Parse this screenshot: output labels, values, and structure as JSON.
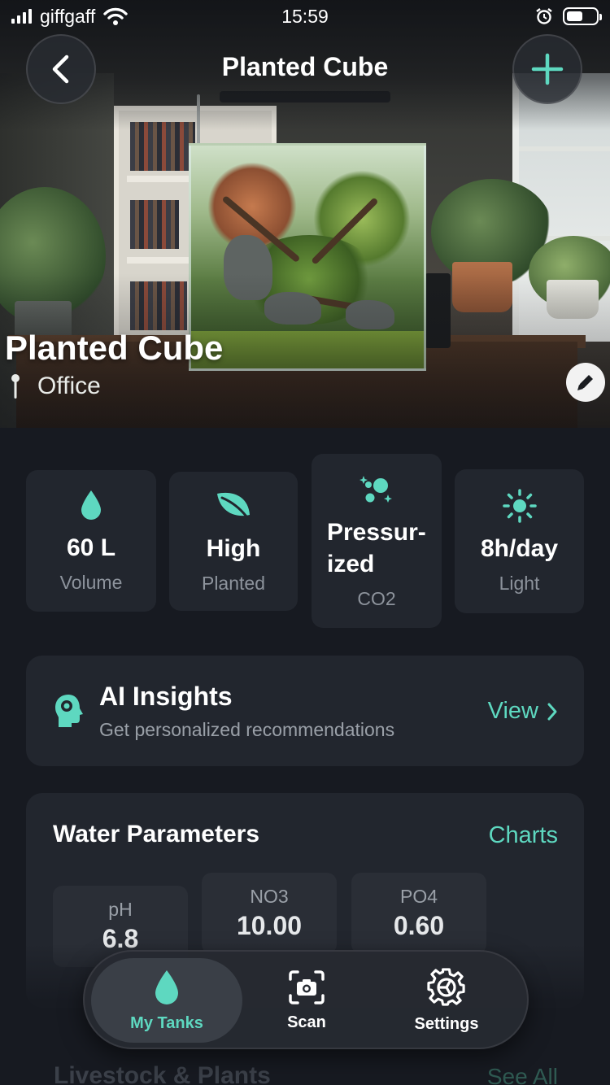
{
  "status_bar": {
    "carrier": "giffgaff",
    "time": "15:59"
  },
  "nav": {
    "title": "Planted Cube",
    "back_icon": "chevron-left-icon",
    "add_icon": "plus-icon"
  },
  "hero": {
    "tank_name": "Planted Cube",
    "location": "Office",
    "location_icon": "pin-icon",
    "edit_icon": "pencil-icon"
  },
  "stats": [
    {
      "value": "60 L",
      "label": "Volume",
      "icon": "water-drop-icon"
    },
    {
      "value": "High",
      "label": "Planted",
      "icon": "leaf-icon"
    },
    {
      "value_line1": "Pressur-",
      "value_line2": "ized",
      "label": "CO2",
      "icon": "bubbles-icon"
    },
    {
      "value": "8h/day",
      "label": "Light",
      "icon": "sun-icon"
    }
  ],
  "ai_insights": {
    "title": "AI Insights",
    "subtitle": "Get personalized recommendations",
    "action": "View",
    "icon": "brain-head-icon"
  },
  "water_parameters": {
    "title": "Water Parameters",
    "action": "Charts",
    "params": [
      {
        "label": "pH",
        "value": "6.8"
      },
      {
        "label": "NO3",
        "value": "10.00"
      },
      {
        "label": "PO4",
        "value": "0.60"
      }
    ]
  },
  "livestock": {
    "title": "Livestock & Plants",
    "action": "See All"
  },
  "tabbar": {
    "tabs": [
      {
        "label": "My Tanks",
        "icon": "water-drop-icon",
        "active": true
      },
      {
        "label": "Scan",
        "icon": "camera-scan-icon",
        "active": false
      },
      {
        "label": "Settings",
        "icon": "gear-icon",
        "active": false
      }
    ]
  },
  "colors": {
    "accent": "#5ed8c0",
    "background": "#171a21",
    "card": "#22262e"
  }
}
